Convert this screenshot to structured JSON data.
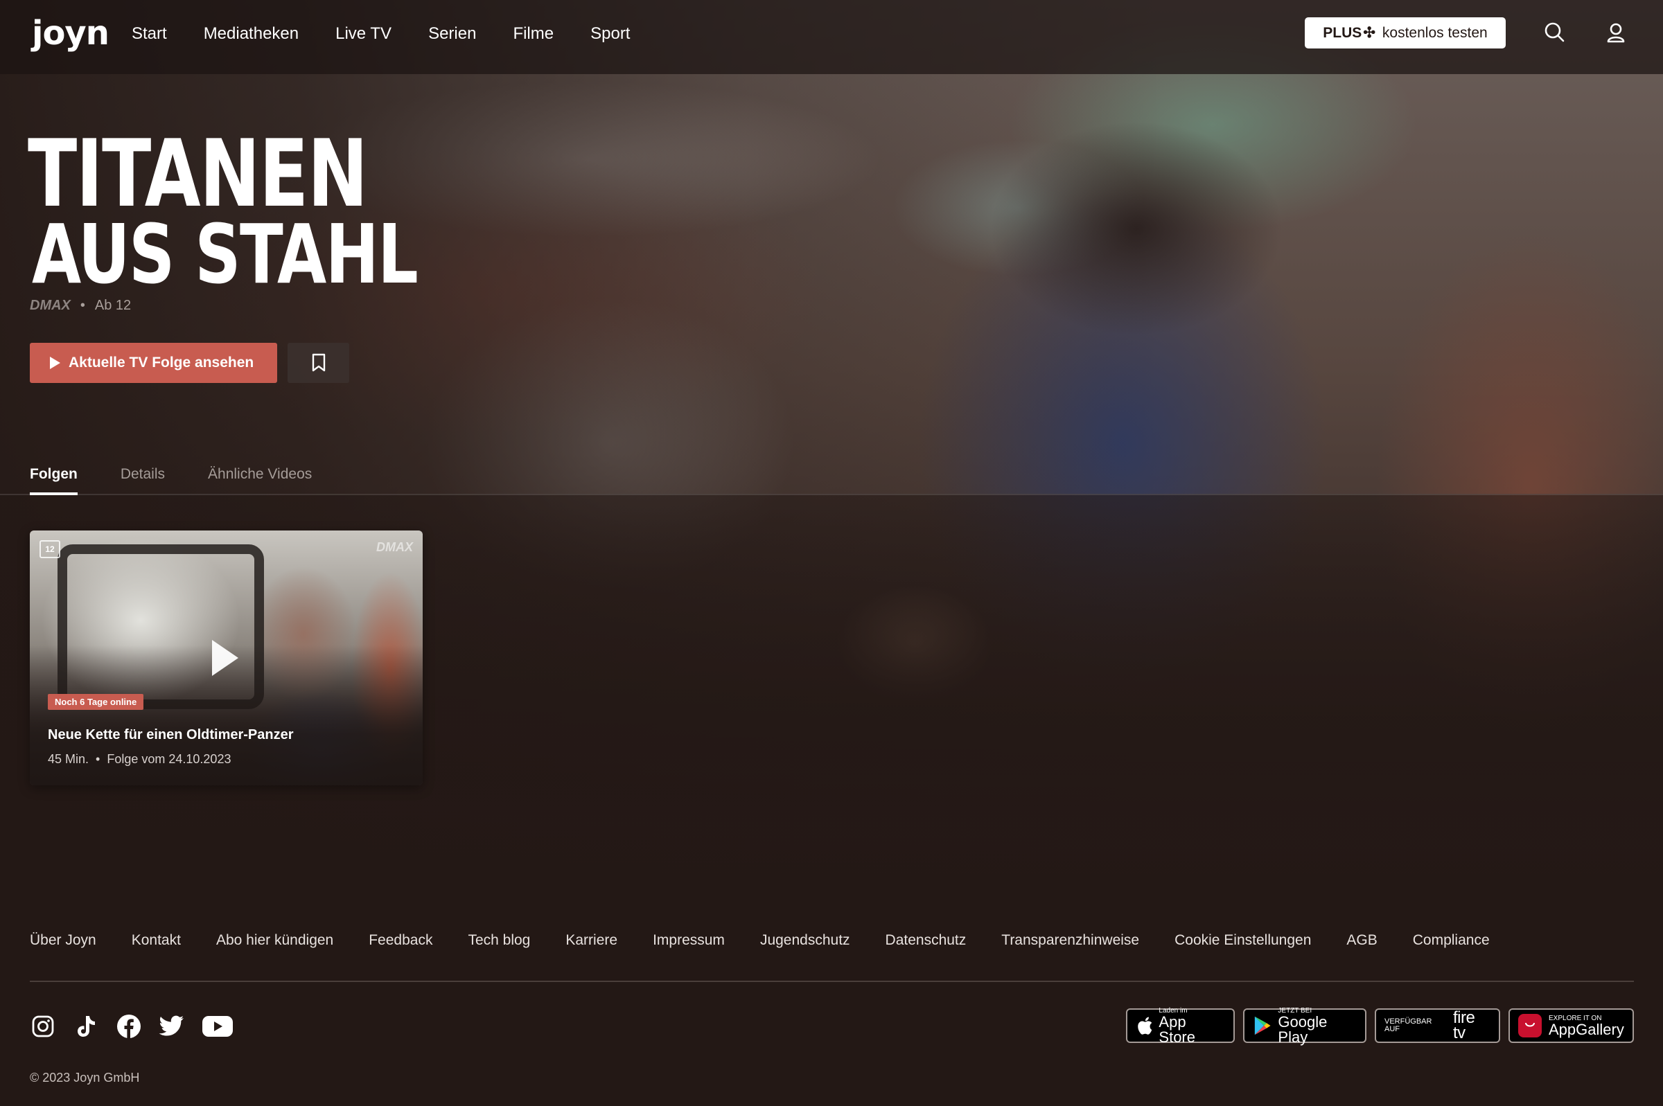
{
  "header": {
    "logo": "joyn",
    "nav": [
      "Start",
      "Mediatheken",
      "Live TV",
      "Serien",
      "Filme",
      "Sport"
    ],
    "plus_label": "PLUS",
    "plus_star": "✣",
    "plus_cta": "kostenlos testen"
  },
  "hero": {
    "title_line1": "TITANEN",
    "title_line2": "AUS STAHL",
    "channel": "DMAX",
    "separator": "•",
    "age_rating": "Ab 12",
    "watch_button": "Aktuelle TV Folge ansehen"
  },
  "tabs": [
    {
      "label": "Folgen",
      "active": true
    },
    {
      "label": "Details",
      "active": false
    },
    {
      "label": "Ähnliche Videos",
      "active": false
    }
  ],
  "episode": {
    "age_icon": "12",
    "channel": "DMAX",
    "badge": "Noch 6 Tage online",
    "title": "Neue Kette für einen Oldtimer-Panzer",
    "duration": "45 Min.",
    "separator": "•",
    "date": "Folge vom 24.10.2023"
  },
  "footer": {
    "links": [
      "Über Joyn",
      "Kontakt",
      "Abo hier kündigen",
      "Feedback",
      "Tech blog",
      "Karriere",
      "Impressum",
      "Jugendschutz",
      "Datenschutz",
      "Transparenzhinweise",
      "Cookie Einstellungen",
      "AGB",
      "Compliance"
    ],
    "social": [
      "instagram-icon",
      "tiktok-icon",
      "facebook-icon",
      "twitter-icon",
      "youtube-icon"
    ],
    "stores": [
      {
        "small": "Laden im",
        "big": "App Store"
      },
      {
        "small": "JETZT BEI",
        "big": "Google Play"
      },
      {
        "small": "VERFÜGBAR AUF",
        "big": "fire tv"
      },
      {
        "small": "EXPLORE IT ON",
        "big": "AppGallery"
      }
    ],
    "copyright": "© 2023 Joyn GmbH"
  },
  "colors": {
    "background": "#231815",
    "accent": "#c85c50"
  }
}
